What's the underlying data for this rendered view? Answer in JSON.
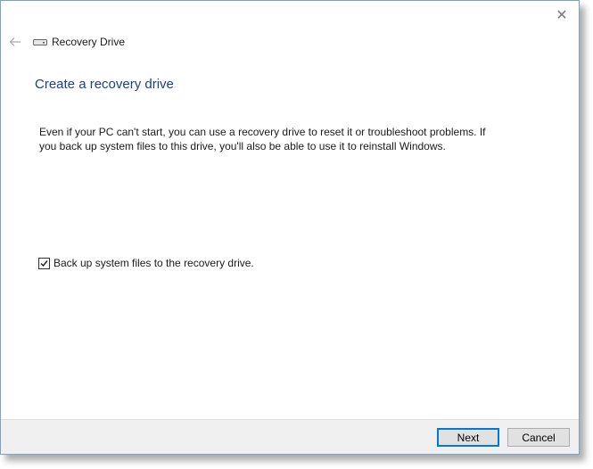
{
  "window": {
    "title": "Recovery Drive",
    "close_glyph": "✕",
    "icons": {
      "back": "back-arrow-icon",
      "drive": "drive-icon",
      "close": "close-icon",
      "check": "checkmark-icon"
    }
  },
  "main": {
    "heading": "Create a recovery drive",
    "description": "Even if your PC can't start, you can use a recovery drive to reset it or troubleshoot problems. If you back up system files to this drive, you'll also be able to use it to reinstall Windows.",
    "backup_checkbox": {
      "label": "Back up system files to the recovery drive.",
      "checked": true
    }
  },
  "footer": {
    "next_label": "Next",
    "cancel_label": "Cancel"
  },
  "colors": {
    "heading": "#1b3f8f",
    "window_border": "#7aa3c9",
    "default_button_border": "#0078d7",
    "footer_bg": "#f0f0f0"
  }
}
